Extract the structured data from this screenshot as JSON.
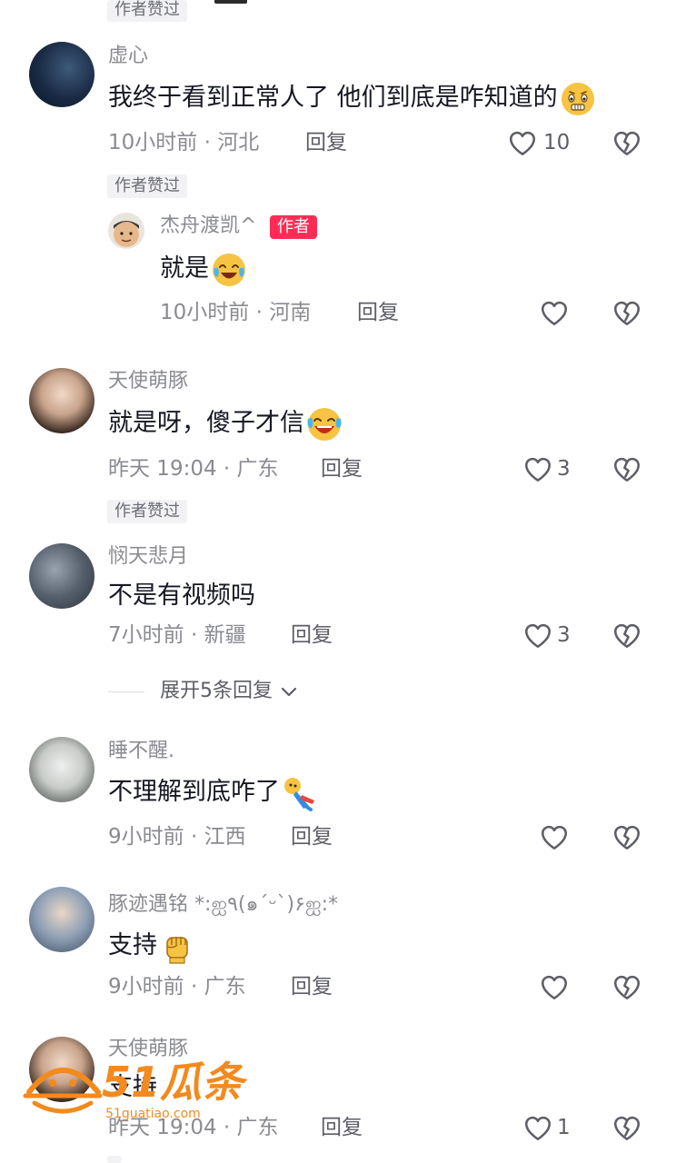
{
  "top_tag": "作者赞过",
  "comments": [
    {
      "name": "虚心",
      "text": "我终于看到正常人了 他们到底是咋知道的",
      "time": "10小时前",
      "location": "河北",
      "reply": "回复",
      "likes": "10",
      "tag": "作者赞过",
      "sub_reply": {
        "name": "杰舟渡凯^",
        "badge": "作者",
        "text": "就是",
        "time": "10小时前",
        "location": "河南",
        "reply": "回复"
      }
    },
    {
      "name": "天使萌豚",
      "text": "就是呀，傻子才信",
      "time": "昨天 19:04",
      "location": "广东",
      "reply": "回复",
      "likes": "3",
      "tag": "作者赞过"
    },
    {
      "name": "悯天悲月",
      "text": "不是有视频吗",
      "time": "7小时前",
      "location": "新疆",
      "reply": "回复",
      "likes": "3",
      "expand": "展开5条回复"
    },
    {
      "name": "睡不醒.",
      "text": "不理解到底咋了",
      "time": "9小时前",
      "location": "江西",
      "reply": "回复"
    },
    {
      "name": "豚迹遇铭 *:ஐ٩(๑´ᵕ`)۶ஐ:*",
      "text": "支持",
      "time": "9小时前",
      "location": "广东",
      "reply": "回复"
    },
    {
      "name": "天使萌豚",
      "text": "支持",
      "time": "昨天 19:04",
      "location": "广东",
      "reply": "回复",
      "likes": "1"
    }
  ],
  "separator": "·",
  "watermark": {
    "brand": "51瓜条",
    "url": "51guatiao.com"
  },
  "icons": {
    "like": "heart-outline-icon",
    "dislike": "broken-heart-icon",
    "expand": "chevron-down-icon"
  },
  "colors": {
    "author_badge": "#fe2c55",
    "watermark": "#f28a1e"
  }
}
